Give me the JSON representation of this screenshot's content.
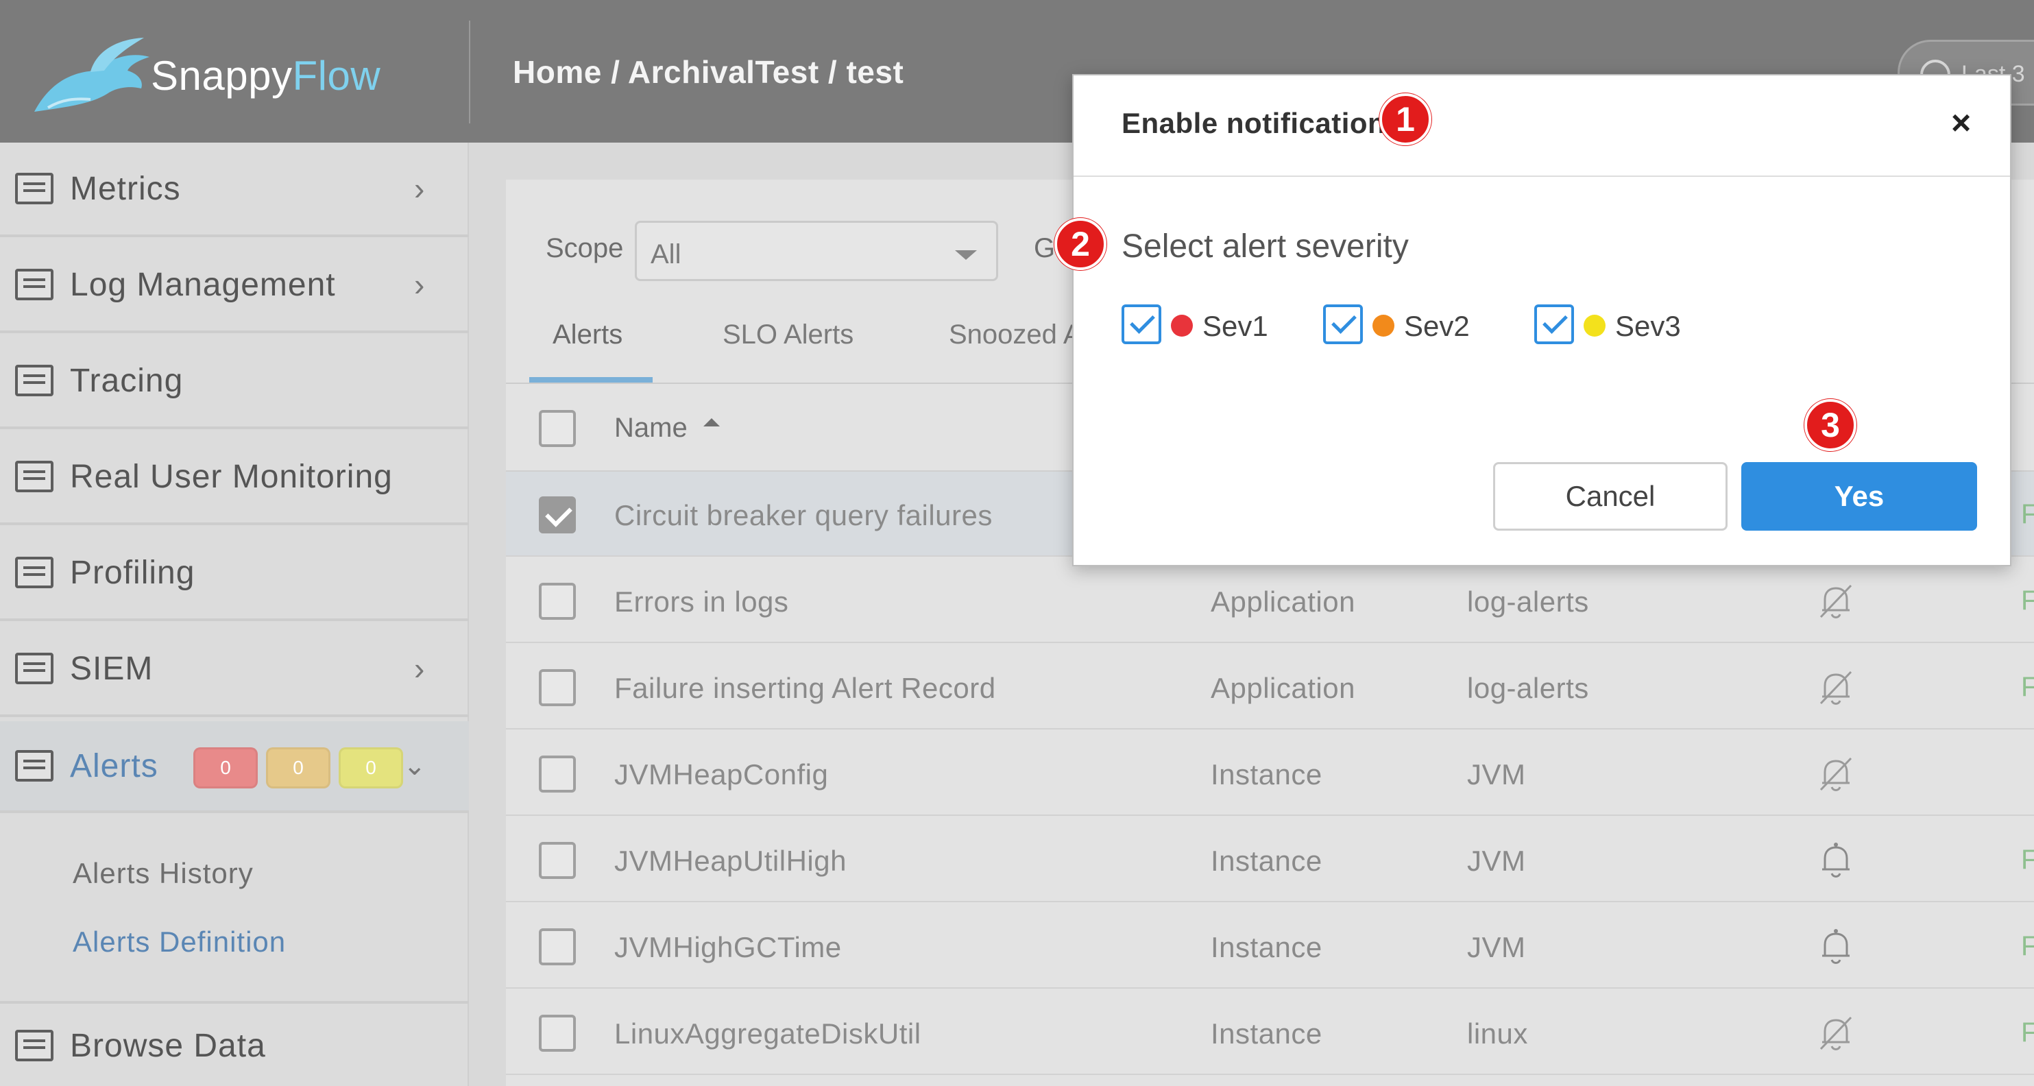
{
  "header": {
    "logo_snappy": "Snappy",
    "logo_flow": "Flow",
    "breadcrumb": "Home / ArchivalTest / test",
    "time_range_partial": "Last 3"
  },
  "sidebar": {
    "items": [
      {
        "label": "Metrics",
        "icon": "metrics-icon",
        "has_chevron": true
      },
      {
        "label": "Log Management",
        "icon": "log-icon",
        "has_chevron": true
      },
      {
        "label": "Tracing",
        "icon": "tracing-icon",
        "has_chevron": false
      },
      {
        "label": "Real User Monitoring",
        "icon": "rum-icon",
        "has_chevron": false
      },
      {
        "label": "Profiling",
        "icon": "profiling-icon",
        "has_chevron": false
      },
      {
        "label": "SIEM",
        "icon": "siem-icon",
        "has_chevron": true
      },
      {
        "label": "Alerts",
        "icon": "alerts-icon",
        "expanded": true
      },
      {
        "label": "Browse Data",
        "icon": "browse-icon",
        "has_chevron": false
      }
    ],
    "alert_badges": [
      {
        "value": "0",
        "color": "#e88a8a"
      },
      {
        "value": "0",
        "color": "#e6c98a"
      },
      {
        "value": "0",
        "color": "#e4e37e"
      }
    ],
    "alerts_subitems": [
      {
        "label": "Alerts History",
        "active": false
      },
      {
        "label": "Alerts Definition",
        "active": true
      }
    ]
  },
  "filters": {
    "scope_label": "Scope",
    "scope_value": "All",
    "next_filter_partial": "G"
  },
  "tabs": [
    {
      "label": "Alerts",
      "active": true
    },
    {
      "label": "SLO Alerts",
      "active": false
    },
    {
      "label": "Snoozed A",
      "active": false
    }
  ],
  "table": {
    "name_header": "Name",
    "rows": [
      {
        "name": "Circuit breaker query failures",
        "scope": "",
        "group": "",
        "bell": "",
        "checked": true
      },
      {
        "name": "Errors in logs",
        "scope": "Application",
        "group": "log-alerts",
        "bell": "bell-off-icon",
        "checked": false
      },
      {
        "name": "Failure inserting Alert Record",
        "scope": "Application",
        "group": "log-alerts",
        "bell": "bell-off-icon",
        "checked": false
      },
      {
        "name": "JVMHeapConfig",
        "scope": "Instance",
        "group": "JVM",
        "bell": "bell-off-icon",
        "checked": false
      },
      {
        "name": "JVMHeapUtilHigh",
        "scope": "Instance",
        "group": "JVM",
        "bell": "bell-icon",
        "checked": false
      },
      {
        "name": "JVMHighGCTime",
        "scope": "Instance",
        "group": "JVM",
        "bell": "bell-icon",
        "checked": false
      },
      {
        "name": "LinuxAggregateDiskUtil",
        "scope": "Instance",
        "group": "linux",
        "bell": "bell-off-icon",
        "checked": false
      }
    ]
  },
  "modal": {
    "title": "Enable notification",
    "close": "×",
    "subtitle": "Select alert severity",
    "severities": [
      {
        "label": "Sev1",
        "color": "#e8343b",
        "checked": true
      },
      {
        "label": "Sev2",
        "color": "#f28a1b",
        "checked": true
      },
      {
        "label": "Sev3",
        "color": "#f3e11c",
        "checked": true
      }
    ],
    "cancel_label": "Cancel",
    "yes_label": "Yes"
  },
  "annotations": {
    "step1": "1",
    "step2": "2",
    "step3": "3",
    "color": "#e21c1c"
  }
}
